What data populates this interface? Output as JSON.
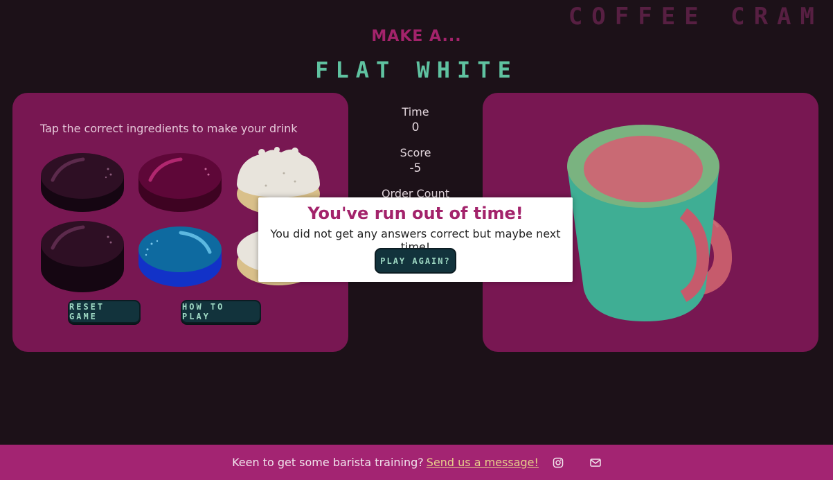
{
  "header": {
    "logo": "COFFEE CRAM",
    "prompt": "MAKE A...",
    "drink": "FLAT WHITE"
  },
  "game": {
    "instruction": "Tap the correct ingredients to make your drink",
    "reset_label": "Reset Game",
    "howto_label": "How to play"
  },
  "stats": {
    "time_label": "Time",
    "time_value": "0",
    "score_label": "Score",
    "score_value": "-5",
    "order_label": "Order Count"
  },
  "modal": {
    "title": "You've run out of time!",
    "message": "You did not get any answers correct but maybe next time!",
    "button_label": "Play again?"
  },
  "footer": {
    "text": "Keen to get some barista training?",
    "link": "Send us a message!",
    "icons": [
      "instagram-icon",
      "mail-icon"
    ]
  },
  "colors": {
    "background": "#1c1118",
    "panel": "#781752",
    "accent": "#a3236b",
    "drink_name": "#5fc2a0",
    "button": "#12333c",
    "footer": "#a32472",
    "cup": "#3fae94",
    "coffee": "#c96a74"
  }
}
